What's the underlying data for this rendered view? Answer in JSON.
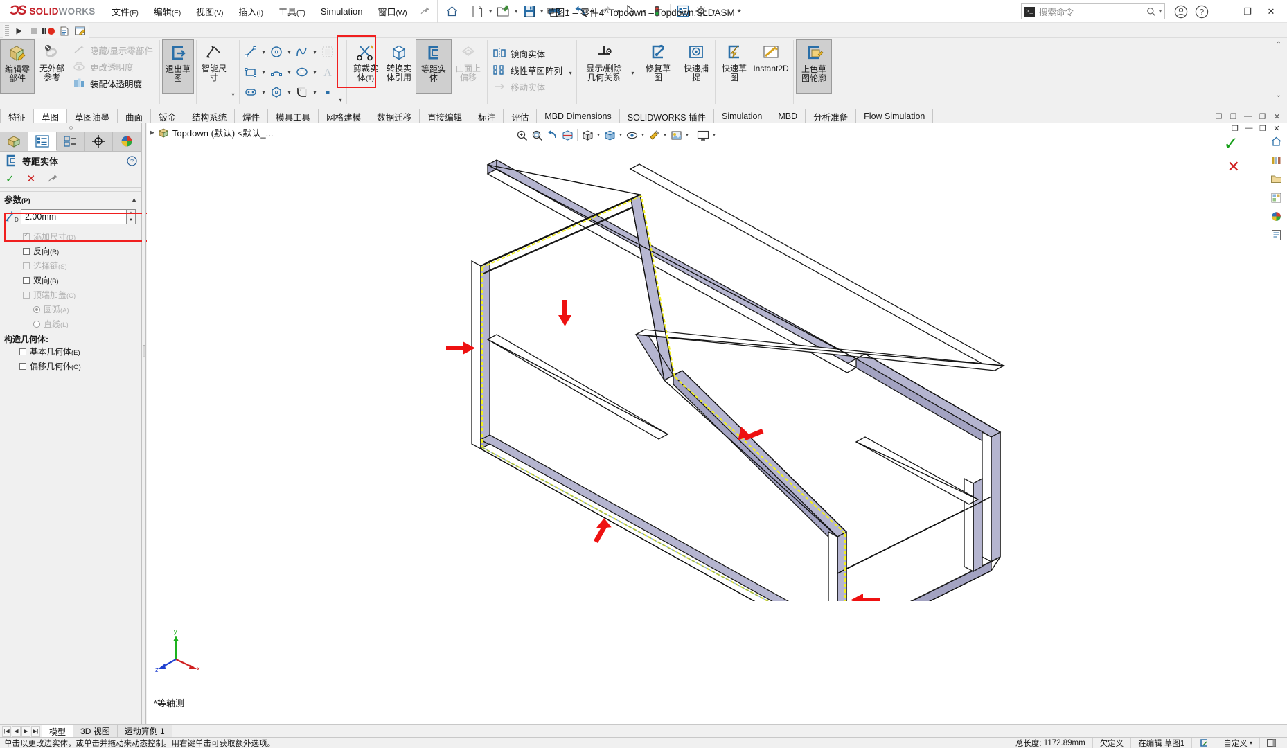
{
  "app": {
    "brand_ds": "2S",
    "brand_solid": "SOLID",
    "brand_works": "WORKS",
    "document_title": "草图1 – 零件4^Topdown – Topdown.SLDASM *"
  },
  "menubar": {
    "items": [
      {
        "label": "文件",
        "mnemonic": "(F)",
        "name": "menu-file"
      },
      {
        "label": "编辑",
        "mnemonic": "(E)",
        "name": "menu-edit"
      },
      {
        "label": "视图",
        "mnemonic": "(V)",
        "name": "menu-view"
      },
      {
        "label": "插入",
        "mnemonic": "(I)",
        "name": "menu-insert"
      },
      {
        "label": "工具",
        "mnemonic": "(T)",
        "name": "menu-tools"
      },
      {
        "label": "Simulation",
        "mnemonic": "",
        "name": "menu-simulation"
      },
      {
        "label": "窗口",
        "mnemonic": "(W)",
        "name": "menu-window"
      }
    ],
    "pin": "pin-icon"
  },
  "quick_access": {
    "buttons": [
      {
        "name": "home-button",
        "icon": "home-icon",
        "dropdown": false
      },
      {
        "name": "new-document-button",
        "icon": "new-file-icon",
        "dropdown": true
      },
      {
        "name": "open-document-button",
        "icon": "open-folder-icon",
        "dropdown": true
      },
      {
        "name": "save-button",
        "icon": "save-floppy-icon",
        "dropdown": true
      },
      {
        "name": "print-button",
        "icon": "printer-icon",
        "dropdown": true
      },
      {
        "name": "undo-button",
        "icon": "undo-arrow-icon",
        "dropdown": true
      },
      {
        "name": "redo-button",
        "icon": "redo-arrow-icon",
        "dropdown": true
      },
      {
        "name": "select-button",
        "icon": "cursor-arrow-icon",
        "dropdown": true
      },
      {
        "name": "rebuild-button",
        "icon": "traffic-light-icon",
        "dropdown": false
      },
      {
        "name": "file-properties-button",
        "icon": "properties-list-icon",
        "dropdown": false
      },
      {
        "name": "options-button",
        "icon": "gear-icon",
        "dropdown": true
      }
    ]
  },
  "search": {
    "placeholder": "搜索命令",
    "prompt_glyph": ">_"
  },
  "window_controls": {
    "account": "account-icon",
    "help": "help-icon",
    "minimize": "—",
    "restore": "❐",
    "close": "✕"
  },
  "playbar": {
    "buttons": [
      {
        "name": "play-button",
        "icon": "play-triangle-icon"
      },
      {
        "name": "stop-button",
        "icon": "stop-square-icon"
      },
      {
        "name": "pause-record-button",
        "icon": "pause-record-icon"
      },
      {
        "name": "new-macro-button",
        "icon": "new-macro-icon"
      },
      {
        "name": "edit-macro-button",
        "icon": "edit-macro-icon"
      }
    ]
  },
  "ribbon": {
    "group_assembly": {
      "edit_component": {
        "line1": "编辑零",
        "line2": "部件",
        "name": "edit-component-button",
        "active": true
      },
      "no_external_refs": {
        "line1": "无外部",
        "line2": "参考",
        "name": "no-external-reference-button"
      },
      "small_items": [
        {
          "label": "隐藏/显示零部件",
          "name": "hide-show-components-item",
          "icon": "hide-show-icon",
          "disabled": true
        },
        {
          "label": "更改透明度",
          "name": "change-transparency-item",
          "icon": "transparency-eye-icon",
          "disabled": true
        },
        {
          "label": "装配体透明度",
          "name": "assembly-transparency-item",
          "icon": "assembly-transparency-icon",
          "disabled": false
        }
      ]
    },
    "exit_sketch": {
      "line1": "退出草",
      "line2": "图",
      "name": "exit-sketch-button",
      "active": true
    },
    "smart_dimension": {
      "line1": "智能尺",
      "line2": "寸",
      "name": "smart-dimension-button"
    },
    "sketch_tools": [
      {
        "name": "line-tool",
        "icon": "line-icon",
        "dropdown": true
      },
      {
        "name": "circle-tool",
        "icon": "circle-icon",
        "dropdown": true
      },
      {
        "name": "spline-tool",
        "icon": "spline-icon",
        "dropdown": true
      },
      {
        "name": "sketch-pattern-tool",
        "icon": "sketch-pattern-icon",
        "dropdown": false
      },
      {
        "name": "rectangle-tool",
        "icon": "rectangle-icon",
        "dropdown": true
      },
      {
        "name": "arc-tool",
        "icon": "arc-icon",
        "dropdown": true
      },
      {
        "name": "ellipse-tool",
        "icon": "ellipse-icon",
        "dropdown": true
      },
      {
        "name": "text-tool",
        "icon": "text-a-icon",
        "dropdown": false
      },
      {
        "name": "slot-tool",
        "icon": "slot-icon",
        "dropdown": true
      },
      {
        "name": "polygon-tool",
        "icon": "polygon-icon",
        "dropdown": false
      },
      {
        "name": "fillet-tool",
        "icon": "sketch-fillet-icon",
        "dropdown": true
      },
      {
        "name": "point-tool",
        "icon": "point-icon",
        "dropdown": false
      }
    ],
    "trim_entities": {
      "line1": "剪裁实",
      "line2": "体",
      "mnemonic": "(T)",
      "name": "trim-entities-button"
    },
    "convert_entities": {
      "line1": "转换实",
      "line2": "体引用",
      "name": "convert-entities-button"
    },
    "offset_entities": {
      "line1": "等距实",
      "line2": "体",
      "name": "offset-entities-button",
      "active": true,
      "highlighted": true
    },
    "offset_on_surface": {
      "line1": "曲面上",
      "line2": "偏移",
      "name": "offset-on-surface-button",
      "disabled": true
    },
    "mirror_linear": [
      {
        "label": "镜向实体",
        "name": "mirror-entities-item",
        "icon": "mirror-entities-icon",
        "disabled": false
      },
      {
        "label": "线性草图阵列",
        "name": "linear-sketch-pattern-item",
        "icon": "linear-pattern-icon",
        "disabled": false,
        "dropdown": true
      },
      {
        "label": "移动实体",
        "name": "move-entities-item",
        "icon": "move-entities-icon",
        "disabled": true,
        "dropdown": true
      }
    ],
    "display_delete_relations": {
      "line1": "显示/删除",
      "line2": "几何关系",
      "name": "display-delete-relations-button",
      "dropdown": true
    },
    "repair_sketch": {
      "line1": "修复草",
      "line2": "图",
      "name": "repair-sketch-button"
    },
    "quick_snap": {
      "line1": "快速捕",
      "line2": "捉",
      "name": "quick-snaps-button"
    },
    "quick_sketch": {
      "line1": "快速草",
      "line2": "图",
      "name": "rapid-sketch-button"
    },
    "instant2d": {
      "line1": "Instant2D",
      "line2": "",
      "name": "instant2d-button"
    },
    "shaded_sketch": {
      "line1": "上色草",
      "line2": "图轮廓",
      "name": "shaded-sketch-contours-button",
      "active": true
    }
  },
  "command_tabs": {
    "items": [
      {
        "label": "特征",
        "name": "tab-features"
      },
      {
        "label": "草图",
        "name": "tab-sketch",
        "selected": true
      },
      {
        "label": "草图油墨",
        "name": "tab-sketch-ink"
      },
      {
        "label": "曲面",
        "name": "tab-surfaces"
      },
      {
        "label": "钣金",
        "name": "tab-sheet-metal"
      },
      {
        "label": "结构系统",
        "name": "tab-structure-system"
      },
      {
        "label": "焊件",
        "name": "tab-weldments"
      },
      {
        "label": "模具工具",
        "name": "tab-mold-tools"
      },
      {
        "label": "网格建模",
        "name": "tab-mesh-modeling"
      },
      {
        "label": "数据迁移",
        "name": "tab-data-migration"
      },
      {
        "label": "直接编辑",
        "name": "tab-direct-editing"
      },
      {
        "label": "标注",
        "name": "tab-markup"
      },
      {
        "label": "评估",
        "name": "tab-evaluate"
      },
      {
        "label": "MBD Dimensions",
        "name": "tab-mbd-dimensions"
      },
      {
        "label": "SOLIDWORKS 插件",
        "name": "tab-solidworks-addins"
      },
      {
        "label": "Simulation",
        "name": "tab-simulation"
      },
      {
        "label": "MBD",
        "name": "tab-mbd"
      },
      {
        "label": "分析准备",
        "name": "tab-analysis-preparation"
      },
      {
        "label": "Flow Simulation",
        "name": "tab-flow-simulation"
      }
    ]
  },
  "property_manager": {
    "tabs": [
      {
        "name": "feature-manager-tab",
        "icon": "feature-tree-icon"
      },
      {
        "name": "property-manager-tab",
        "icon": "property-list-icon",
        "selected": true
      },
      {
        "name": "configuration-manager-tab",
        "icon": "configuration-icon"
      },
      {
        "name": "dimxpert-manager-tab",
        "icon": "dimxpert-icon"
      },
      {
        "name": "display-manager-tab",
        "icon": "appearance-sphere-icon"
      }
    ],
    "title": "等距实体",
    "title_icon": "offset-entities-icon",
    "actions": {
      "ok": "✓",
      "cancel": "✕",
      "pin": "pin-icon"
    },
    "help_icon": "help-question-icon",
    "parameters_section": {
      "label": "参数",
      "mnemonic": "(P)",
      "offset_value": "2.00mm",
      "offset_icon": "offset-distance-icon"
    },
    "options": [
      {
        "label": "添加尺寸",
        "mnemonic": "(D)",
        "checked": true,
        "disabled": true,
        "name": "add-dimensions-checkbox"
      },
      {
        "label": "反向",
        "mnemonic": "(R)",
        "checked": false,
        "disabled": false,
        "name": "reverse-checkbox"
      },
      {
        "label": "选择链",
        "mnemonic": "(S)",
        "checked": false,
        "disabled": true,
        "name": "select-chain-checkbox"
      },
      {
        "label": "双向",
        "mnemonic": "(B)",
        "checked": false,
        "disabled": false,
        "name": "bi-directional-checkbox"
      },
      {
        "label": "顶端加盖",
        "mnemonic": "(C)",
        "checked": false,
        "disabled": true,
        "name": "cap-ends-checkbox"
      }
    ],
    "cap_radios": [
      {
        "label": "圆弧",
        "mnemonic": "(A)",
        "selected": true,
        "name": "arcs-radio"
      },
      {
        "label": "直线",
        "mnemonic": "(L)",
        "selected": false,
        "name": "lines-radio"
      }
    ],
    "construction_geometry": {
      "title": "构造几何体:",
      "items": [
        {
          "label": "基本几何体",
          "mnemonic": "(E)",
          "checked": false,
          "name": "base-geometry-checkbox"
        },
        {
          "label": "偏移几何体",
          "mnemonic": "(O)",
          "checked": false,
          "name": "offset-geometry-checkbox"
        }
      ]
    }
  },
  "graphics": {
    "tree_root": "Topdown (默认) <默认_...",
    "tree_icon": "assembly-icon",
    "view_label": "*等轴测",
    "triad": {
      "x": "x",
      "y": "y",
      "z": "z"
    },
    "heads_up_toolbar": [
      {
        "name": "zoom-to-fit-button",
        "icon": "zoom-fit-icon"
      },
      {
        "name": "zoom-to-area-button",
        "icon": "zoom-area-icon"
      },
      {
        "name": "previous-view-button",
        "icon": "previous-view-icon"
      },
      {
        "name": "section-view-button",
        "icon": "section-view-icon"
      },
      {
        "name": "view-orientation-button",
        "icon": "view-orientation-icon",
        "dropdown": true
      },
      {
        "name": "display-style-button",
        "icon": "display-style-icon",
        "dropdown": true
      },
      {
        "name": "hide-show-items-button",
        "icon": "hide-show-items-icon",
        "dropdown": true
      },
      {
        "name": "edit-appearance-button",
        "icon": "appearance-icon",
        "dropdown": true
      },
      {
        "name": "apply-scene-button",
        "icon": "scene-icon",
        "dropdown": true
      },
      {
        "name": "view-settings-button",
        "icon": "view-settings-icon",
        "dropdown": true
      }
    ],
    "confirmation_corner": {
      "ok": "✓",
      "cancel": "✕"
    },
    "right_toolbar": [
      {
        "name": "view-palette-home-icon",
        "icon": "home-icon"
      },
      {
        "name": "design-library-icon",
        "icon": "library-icon"
      },
      {
        "name": "file-explorer-icon",
        "icon": "folder-icon"
      },
      {
        "name": "view-palette-icon",
        "icon": "palette-icon"
      },
      {
        "name": "appearances-icon",
        "icon": "appearance-sphere-icon"
      },
      {
        "name": "custom-properties-icon",
        "icon": "custom-properties-icon"
      }
    ]
  },
  "document_tabs": {
    "items": [
      {
        "label": "模型",
        "name": "doc-tab-model",
        "selected": true
      },
      {
        "label": "3D 视图",
        "name": "doc-tab-3d-views"
      },
      {
        "label": "运动算例 1",
        "name": "doc-tab-motion-study-1"
      }
    ]
  },
  "status_bar": {
    "message": "单击以更改边实体，或单击并拖动来动态控制。用右键单击可获取额外选项。",
    "total_length_label": "总长度:",
    "total_length_value": "1172.89mm",
    "under_defined": "欠定义",
    "editing": "在编辑 草图1",
    "custom": "自定义",
    "sketch_status_icon": "sketch-status-icon"
  }
}
